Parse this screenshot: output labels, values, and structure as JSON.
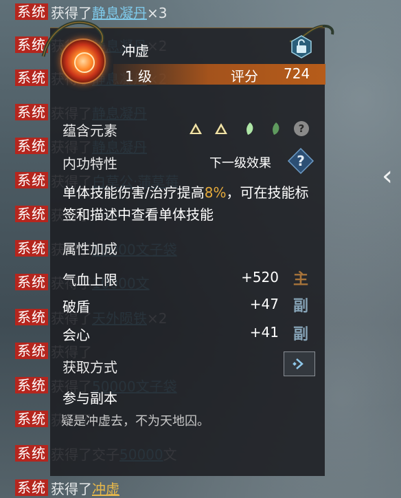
{
  "chat": {
    "tag": "系统",
    "lines": [
      {
        "prefix": "获得了",
        "item": "静息凝丹",
        "count": "×3",
        "gold": false
      },
      {
        "prefix": "获得了",
        "item": "静息凝丹",
        "count": "×2",
        "gold": false
      },
      {
        "prefix": "获得了",
        "item": "静息凝丹",
        "count": "×2",
        "gold": false
      },
      {
        "prefix": "获得了",
        "item": "静息凝丹",
        "count": "",
        "gold": false
      },
      {
        "prefix": "获得了",
        "item": "静息凝丹",
        "count": "",
        "gold": false
      },
      {
        "prefix": "获得了",
        "item": "白草公·蒲草莓",
        "count": "",
        "gold": false
      },
      {
        "prefix": "获得了",
        "item": "",
        "count": "",
        "gold": false
      },
      {
        "prefix": "获得了",
        "item": "50000文子袋",
        "count": "",
        "gold": false
      },
      {
        "prefix": "获得了",
        "item": "10000文",
        "count": "",
        "gold": false
      },
      {
        "prefix": "获得了",
        "item": "天外陨铁",
        "count": "×2",
        "gold": false
      },
      {
        "prefix": "获得了",
        "item": "",
        "count": "",
        "gold": false
      },
      {
        "prefix": "获得了",
        "item": "50000文子袋",
        "count": "",
        "gold": false
      },
      {
        "prefix": "获得了",
        "item": "",
        "count": "",
        "gold": false
      },
      {
        "prefix": "获得了交子",
        "item": "50000",
        "count": "文",
        "gold": false
      },
      {
        "prefix": "获得了",
        "item": "冲虚",
        "count": "",
        "gold": true
      }
    ]
  },
  "tooltip": {
    "title": "冲虚",
    "level": "1 级",
    "score_label": "评分",
    "score_value": "724",
    "elements_label": "蕴含元素",
    "elements": [
      {
        "icon": "triangle-icon",
        "color": "#e8d79a"
      },
      {
        "icon": "triangle-icon",
        "color": "#e8d79a"
      },
      {
        "icon": "leaf-icon",
        "color": "#9bdc9a"
      },
      {
        "icon": "leaf-icon",
        "color": "#6da86c"
      }
    ],
    "trait_label": "内功特性",
    "next_level_label": "下一级效果",
    "desc_pre": "单体技能伤害/治疗提高",
    "desc_pct": "8%",
    "desc_post": "，可在技能标签和描述中查看单体技能",
    "attr_section": "属性加成",
    "attrs": [
      {
        "name": "气血上限",
        "value": "+520",
        "tag": "主"
      },
      {
        "name": "破盾",
        "value": "+47",
        "tag": "副"
      },
      {
        "name": "会心",
        "value": "+41",
        "tag": "副"
      }
    ],
    "acquire_label": "获取方式",
    "acquire_source": "参与副本",
    "flavor": "疑是冲虚去，不为天地囚。"
  },
  "colors": {
    "accent_orange": "#b65c1a",
    "highlight_gold": "#e6ab3c",
    "chat_tag_red": "#b5261e",
    "item_blue": "#7fc9e9"
  }
}
